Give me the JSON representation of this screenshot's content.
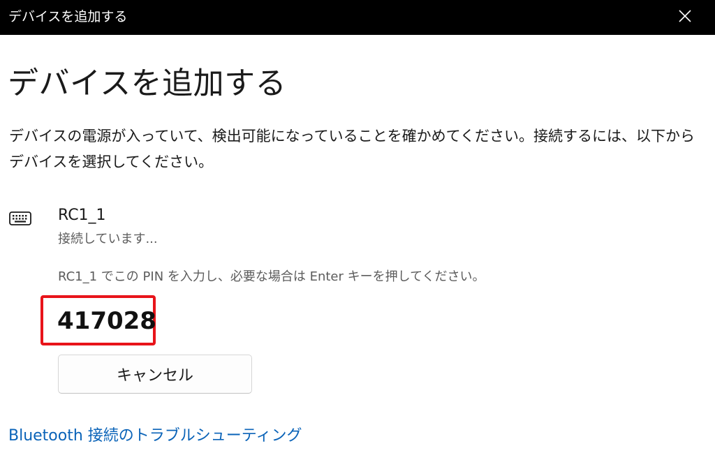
{
  "window": {
    "title": "デバイスを追加する",
    "close_icon": "close-icon"
  },
  "main": {
    "heading": "デバイスを追加する",
    "description": "デバイスの電源が入っていて、検出可能になっていることを確かめてください。接続するには、以下からデバイスを選択してください。"
  },
  "device": {
    "icon": "keyboard-icon",
    "name": "RC1_1",
    "status": "接続しています...",
    "pin_instruction": "RC1_1 でこの PIN を入力し、必要な場合は Enter キーを押してください。",
    "pin": "417028",
    "highlight_color": "#e8141a"
  },
  "actions": {
    "cancel_label": "キャンセル"
  },
  "footer": {
    "troubleshoot_link": "Bluetooth 接続のトラブルシューティング",
    "link_color": "#0a63b8"
  }
}
